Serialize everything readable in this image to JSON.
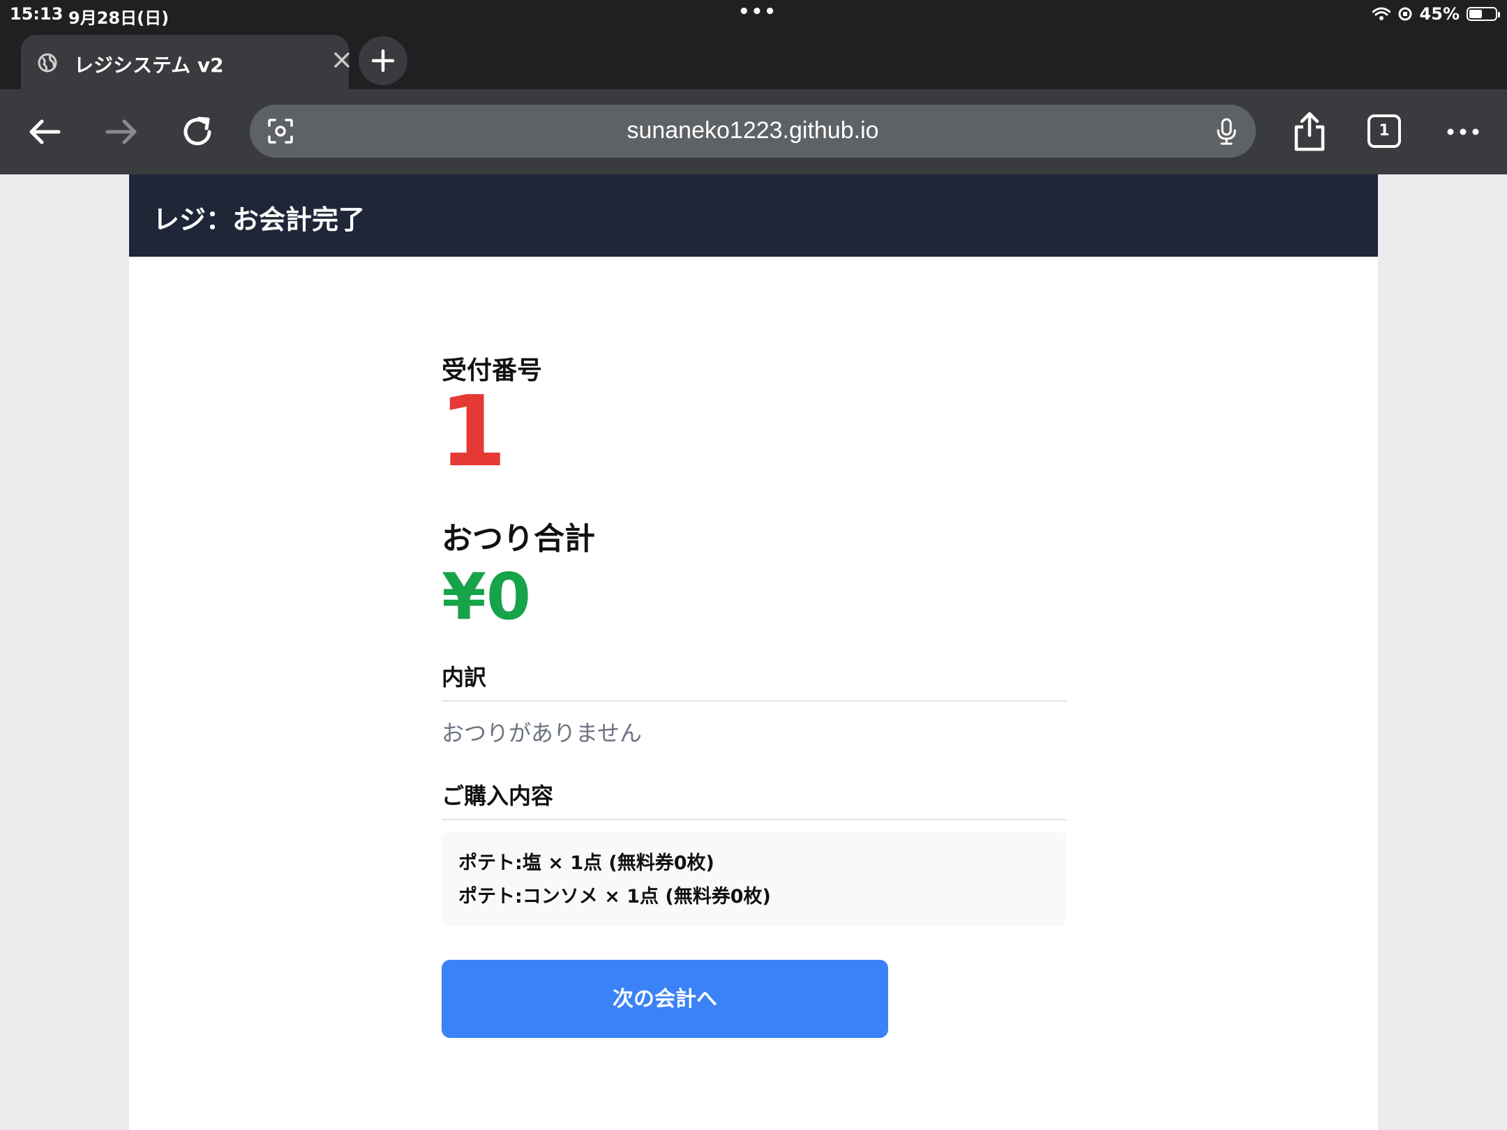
{
  "status_bar": {
    "time": "15:13",
    "date": "9月28日(日)",
    "battery_percent": "45%",
    "battery_level": 0.45,
    "multitask_dots": "•••"
  },
  "browser": {
    "tab": {
      "title": "レジシステム v2",
      "favicon": "globe-icon"
    },
    "new_tab_icon": "plus-icon",
    "url": "sunaneko1223.github.io",
    "tab_count": "1",
    "icons": [
      "back-arrow-icon",
      "forward-arrow-icon",
      "reload-icon",
      "lens-icon",
      "mic-icon",
      "share-icon",
      "more-icon"
    ]
  },
  "page": {
    "header_title": "レジ：お会計完了",
    "receipt_label": "受付番号",
    "receipt_number": "1",
    "change_label": "おつり合計",
    "change_total": "¥0",
    "breakdown_label": "内訳",
    "breakdown_empty": "おつりがありません",
    "purchase_label": "ご購入内容",
    "items": [
      "ポテト:塩 × 1点 (無料券0枚)",
      "ポテト:コンソメ × 1点 (無料券0枚)"
    ],
    "next_button": "次の会計へ"
  },
  "colors": {
    "header_bg": "#1e2638",
    "receipt_number": "#e53935",
    "change_total": "#16a34a",
    "button": "#3b82f6"
  }
}
